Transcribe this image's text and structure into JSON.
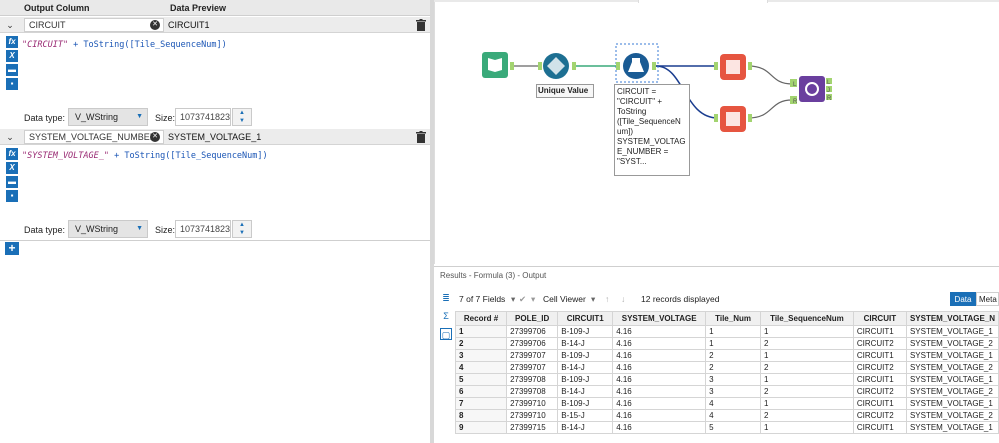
{
  "left_panel": {
    "header": {
      "output_column": "Output Column",
      "data_preview": "Data Preview"
    },
    "fields": [
      {
        "name": "CIRCUIT",
        "preview": "CIRCUIT1",
        "expr_string": "\"CIRCUIT\"",
        "expr_rest": " + ToString([Tile_SequenceNum])",
        "data_type_label": "Data type:",
        "data_type": "V_WString",
        "size_label": "Size:",
        "size": "1073741823"
      },
      {
        "name": "SYSTEM_VOLTAGE_NUMBER",
        "preview": "SYSTEM_VOLTAGE_1",
        "expr_string": "\"SYSTEM_VOLTAGE_\"",
        "expr_rest": " + ToString([Tile_SequenceNum])",
        "data_type_label": "Data type:",
        "data_type": "V_WString",
        "size_label": "Size:",
        "size": "1073741823"
      }
    ],
    "tool_icons": [
      "fx-icon",
      "x-variable-icon",
      "saved-expressions-icon",
      "save-icon"
    ]
  },
  "workflow": {
    "unique_label": "Unique Value",
    "formula_annotation": [
      "CIRCUIT =",
      "\"CIRCUIT\" +",
      "ToString",
      "([Tile_SequenceN",
      "um])",
      "SYSTEM_VOLTAG",
      "E_NUMBER =",
      "\"SYST..."
    ],
    "join_ports": [
      "L",
      "J",
      "R"
    ]
  },
  "results": {
    "title": "Results - Formula (3) - Output",
    "fields_label": "7 of 7 Fields",
    "cell_viewer": "Cell Viewer",
    "records_label": "12 records displayed",
    "data_tab": "Data",
    "meta_tab": "Meta",
    "columns": [
      "Record #",
      "POLE_ID",
      "CIRCUIT1",
      "SYSTEM_VOLTAGE",
      "Tile_Num",
      "Tile_SequenceNum",
      "CIRCUIT",
      "SYSTEM_VOLTAGE_N"
    ],
    "rows": [
      [
        "1",
        "27399706",
        "B-109-J",
        "4.16",
        "1",
        "1",
        "CIRCUIT1",
        "SYSTEM_VOLTAGE_1"
      ],
      [
        "2",
        "27399706",
        "B-14-J",
        "4.16",
        "1",
        "2",
        "CIRCUIT2",
        "SYSTEM_VOLTAGE_2"
      ],
      [
        "3",
        "27399707",
        "B-109-J",
        "4.16",
        "2",
        "1",
        "CIRCUIT1",
        "SYSTEM_VOLTAGE_1"
      ],
      [
        "4",
        "27399707",
        "B-14-J",
        "4.16",
        "2",
        "2",
        "CIRCUIT2",
        "SYSTEM_VOLTAGE_2"
      ],
      [
        "5",
        "27399708",
        "B-109-J",
        "4.16",
        "3",
        "1",
        "CIRCUIT1",
        "SYSTEM_VOLTAGE_1"
      ],
      [
        "6",
        "27399708",
        "B-14-J",
        "4.16",
        "3",
        "2",
        "CIRCUIT2",
        "SYSTEM_VOLTAGE_2"
      ],
      [
        "7",
        "27399710",
        "B-109-J",
        "4.16",
        "4",
        "1",
        "CIRCUIT1",
        "SYSTEM_VOLTAGE_1"
      ],
      [
        "8",
        "27399710",
        "B-15-J",
        "4.16",
        "4",
        "2",
        "CIRCUIT2",
        "SYSTEM_VOLTAGE_2"
      ],
      [
        "9",
        "27399715",
        "B-14-J",
        "4.16",
        "5",
        "1",
        "CIRCUIT1",
        "SYSTEM_VOLTAGE_1"
      ]
    ]
  },
  "colors": {
    "accent": "#1a6fb7",
    "input_tool": "#3aaa7a",
    "unique_tool": "#1d6f92",
    "formula_tool": "#1a5b94",
    "select_tool": "#e65540",
    "join_tool": "#6a3f9e"
  }
}
